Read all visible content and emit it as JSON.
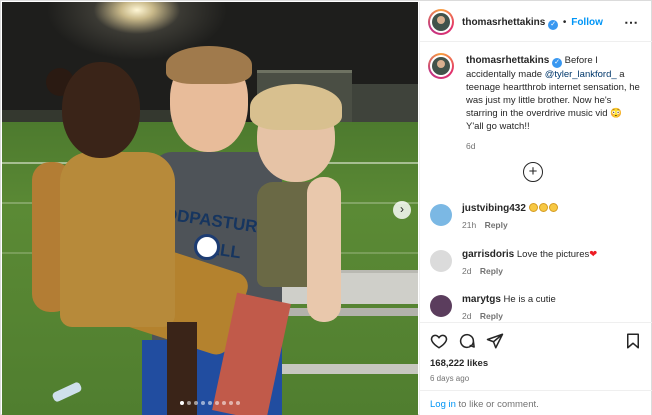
{
  "post": {
    "author": "thomasrhettakins",
    "follow_label": "Follow",
    "caption_before_mention": "Before I accidentally made ",
    "caption_mention": "@tyler_lankford_",
    "caption_after_mention": " a teenage heartthrob internet sensation, he was just my little brother. Now he's starring in the overdrive music vid",
    "caption_end": " Y'all go watch!!",
    "caption_time": "6d",
    "likes": "168,222 likes",
    "posted_ago": "6 days ago",
    "shirt_text_line1": "ODPASTURI",
    "shirt_text_line2": "BALL"
  },
  "comments": [
    {
      "user": "justvibing432",
      "text": "",
      "time": "21h",
      "reply": "Reply"
    },
    {
      "user": "garrisdoris",
      "text": "Love the pictures",
      "time": "2d",
      "reply": "Reply"
    },
    {
      "user": "marytgs",
      "text": "He is a cutie",
      "time": "2d",
      "reply": "Reply"
    }
  ],
  "footer": {
    "login_link": "Log in",
    "rest": " to like or comment."
  },
  "carousel": {
    "slides": 9,
    "active_index": 0
  },
  "colors": {
    "link_blue": "#0095f6",
    "mention_blue": "#00376b",
    "verified_blue": "#3897f0",
    "muted": "#737373",
    "heart_red": "#ed1c24"
  },
  "icons": [
    "more-icon",
    "next-arrow-icon",
    "verified-icon",
    "add-comments-icon",
    "heart-icon",
    "comment-icon",
    "share-icon",
    "bookmark-icon"
  ]
}
